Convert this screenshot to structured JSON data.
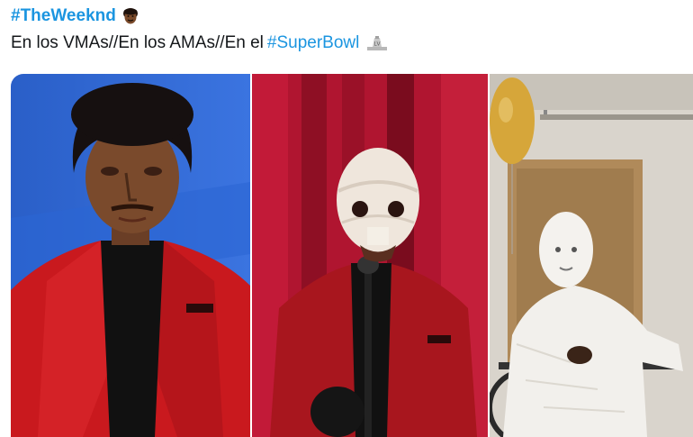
{
  "tweet": {
    "hashtag": "#TheWeeknd",
    "text_main": "En los VMAs//En los AMAs//En el ",
    "text_link": "#SuperBowl",
    "icons": {
      "head_emoji": "man-face-emoji-icon",
      "superbowl_logo": "super-bowl-lv-logo-icon"
    }
  },
  "media": {
    "panels": [
      {
        "subject": "vmas-photo"
      },
      {
        "subject": "amas-photo"
      },
      {
        "subject": "superbowl-photo"
      }
    ]
  },
  "colors": {
    "link": "#1b95e0",
    "text": "#14171a",
    "suit_red": "#c9191e",
    "stage_red": "#b01530"
  }
}
